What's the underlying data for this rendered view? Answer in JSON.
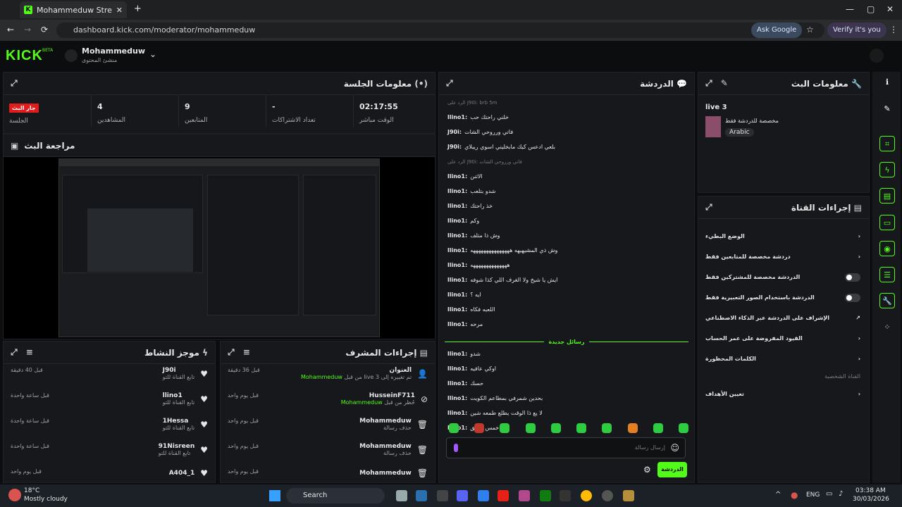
{
  "browser": {
    "tab_title": "Mohammeduw Stream - Kick D",
    "url": "dashboard.kick.com/moderator/mohammeduw",
    "ask_google": "Ask Google",
    "verify": "Verify it's you"
  },
  "header": {
    "logo": "KICK",
    "beta": "BETA",
    "channel_name": "Mohammeduw",
    "channel_role": "منشئ المحتوى"
  },
  "session": {
    "title": "معلومات الجلسة",
    "live_badge": "جار البث",
    "stats": [
      {
        "label": "الجلسة",
        "value": ""
      },
      {
        "label": "المشاهدين",
        "value": "4"
      },
      {
        "label": "المتابعين",
        "value": "9"
      },
      {
        "label": "تعداد الاشتراكات",
        "value": "-"
      },
      {
        "label": "الوقت مباشر",
        "value": "02:17:55"
      }
    ]
  },
  "preview": {
    "title": "مراجعة البث"
  },
  "activity": {
    "title": "موجز النشاط",
    "items": [
      {
        "name": "J90i",
        "sub": "تابع القناة للتو",
        "time": "قبل 40 دقيقة"
      },
      {
        "name": "llino1",
        "sub": "تابع القناة للتو",
        "time": "قبل ساعة واحدة"
      },
      {
        "name": "1Hessa",
        "sub": "تابع القناة للتو",
        "time": "قبل ساعة واحدة"
      },
      {
        "name": "91Nisreen",
        "sub": "تابع القناة للتو",
        "time": "قبل ساعة واحدة"
      },
      {
        "name": "A404_1",
        "sub": "",
        "time": "قبل يوم واحد"
      }
    ]
  },
  "modactions": {
    "title": "إجراءات المشرف",
    "items": [
      {
        "name": "العنوان",
        "sub_pre": "Mohammeduw",
        "sub": "من قبل live 3 تم تغييره إلى",
        "time": "قبل 36 دقيقة"
      },
      {
        "name": "HusseinF711",
        "sub_pre": "Mohammeduw",
        "sub": "حُظر من قبل",
        "time": "قبل يوم واحد"
      },
      {
        "name": "Mohammeduw",
        "sub_pre": "",
        "sub": "حذف رسالة",
        "time": "قبل يوم واحد"
      },
      {
        "name": "Mohammeduw",
        "sub_pre": "",
        "sub": "حذف رسالة",
        "time": "قبل يوم واحد"
      },
      {
        "name": "Mohammeduw",
        "sub_pre": "",
        "sub": "",
        "time": "قبل يوم واحد"
      }
    ]
  },
  "chat": {
    "title": "الدردشة",
    "new_messages": "رسائل جديدة",
    "input_placeholder": "إرسال رسالة",
    "send": "الدردشة",
    "lines": [
      {
        "reply": "الرد على J90i: brb 5m",
        "user": "",
        "text": ""
      },
      {
        "reply": "",
        "user": "llino1:",
        "text": "خلني راحتك حب"
      },
      {
        "reply": "",
        "user": "J90i:",
        "text": "فاتي ورروحي الشات"
      },
      {
        "reply": "",
        "user": "J90i:",
        "text": "بلعي ادعس كيك مابخليني اسوي ريبلاي"
      },
      {
        "reply": "الرد على J90i: فاتي ورروحي الشات",
        "user": "",
        "text": ""
      },
      {
        "reply": "",
        "user": "llino1:",
        "text": "الاثنن"
      },
      {
        "reply": "",
        "user": "llino1:",
        "text": "شدو بتلعب"
      },
      {
        "reply": "",
        "user": "llino1:",
        "text": "خذ راحتك"
      },
      {
        "reply": "",
        "user": "llino1:",
        "text": "وكم"
      },
      {
        "reply": "",
        "user": "llino1:",
        "text": "وش ذا متلف"
      },
      {
        "reply": "",
        "user": "llino1:",
        "text": "وش ذي المشيهيهه هههههههههههههههه"
      },
      {
        "reply": "",
        "user": "llino1:",
        "text": "ههههههههههههههه"
      },
      {
        "reply": "",
        "user": "llino1:",
        "text": "ايش يا شيخ ولا الغرف اللي كذا شوفه"
      },
      {
        "reply": "",
        "user": "llino1:",
        "text": "ايه ؟"
      },
      {
        "reply": "",
        "user": "llino1:",
        "text": "اللعبه فكاه"
      },
      {
        "reply": "",
        "user": "llino1:",
        "text": "مرحه"
      }
    ],
    "after": [
      {
        "user": "llino1:",
        "text": "شدو"
      },
      {
        "user": "llino1:",
        "text": "اوكي عافيه"
      },
      {
        "user": "llino1:",
        "text": "حسك"
      },
      {
        "user": "llino1:",
        "text": "بحدين شمرفي بمطاعم الكويت"
      },
      {
        "user": "llino1:",
        "text": "لا يع ذا الوقت يطلع طمعه شين"
      },
      {
        "user": "llino1:",
        "text": "اما خمس دقايق"
      }
    ]
  },
  "streaminfo": {
    "title": "معلومات البث",
    "stream_title": "live 3",
    "category": "مخصصة للدردشة فقط",
    "tag": "Arabic"
  },
  "channelactions": {
    "title": "إجراءات القناة",
    "items": [
      {
        "label": "الوضع البطيء",
        "kind": "arrow"
      },
      {
        "label": "دردشة مخصصة للمتابعين فقط",
        "kind": "arrow"
      },
      {
        "label": "الدردشة مخصصة للمشتركين فقط",
        "kind": "toggle"
      },
      {
        "label": "الدردشة باستخدام الصور التعبيرية فقط",
        "kind": "toggle"
      },
      {
        "label": "الإشراف على الدردشة عبر الذكاء الاصطناعي",
        "kind": "ext"
      },
      {
        "label": "القيود المفروضة على عمر الحساب",
        "kind": "arrow"
      },
      {
        "label": "الكلمات المحظورة",
        "kind": "arrow"
      }
    ],
    "section_label": "القناة الشخصية",
    "targets": "تعيين الأهداف"
  },
  "taskbar": {
    "temp": "18°C",
    "weather": "Mostly cloudy",
    "search": "Search",
    "lang": "ENG",
    "time": "03:38 AM",
    "date": "30/03/2026"
  }
}
